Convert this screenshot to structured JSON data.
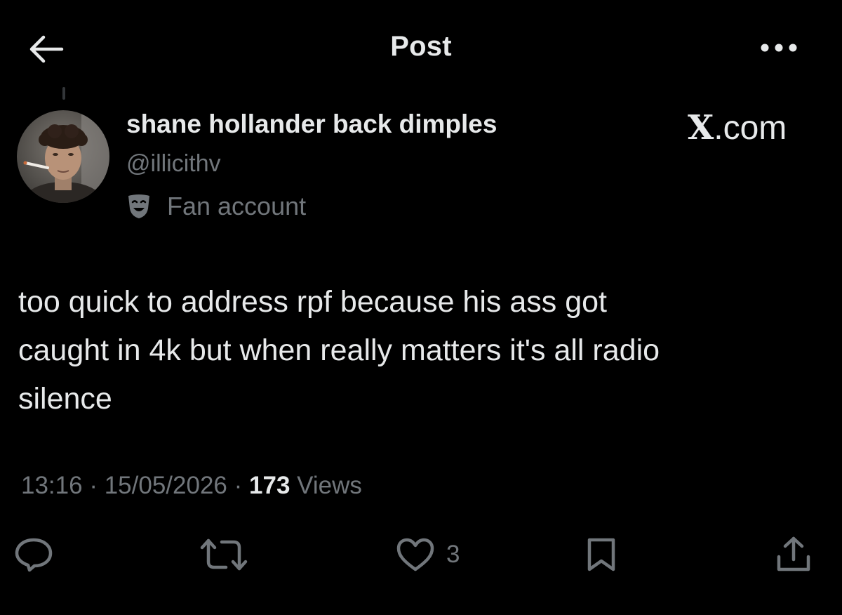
{
  "header": {
    "title": "Post",
    "back_icon": "arrow-left-icon",
    "more_icon": "more-horizontal-icon"
  },
  "author": {
    "display_name": "shane hollander back dimples",
    "handle": "@illicithv",
    "label_icon": "theater-mask-icon",
    "label": "Fan account"
  },
  "watermark": {
    "x_glyph": "X",
    "domain": ".com"
  },
  "post": {
    "text": "too quick to address rpf because his ass got\ncaught in 4k but when really matters it's all radio\nsilence"
  },
  "meta": {
    "time": "13:16",
    "separator": "·",
    "date": "15/05/2026",
    "views_count": "173",
    "views_label": "Views"
  },
  "actions": {
    "reply_icon": "reply-icon",
    "repost_icon": "repost-icon",
    "like_icon": "heart-icon",
    "like_count": "3",
    "bookmark_icon": "bookmark-icon",
    "share_icon": "share-icon"
  },
  "colors": {
    "background": "#000000",
    "primary_text": "#e7e9ea",
    "secondary_text": "#71767b"
  }
}
